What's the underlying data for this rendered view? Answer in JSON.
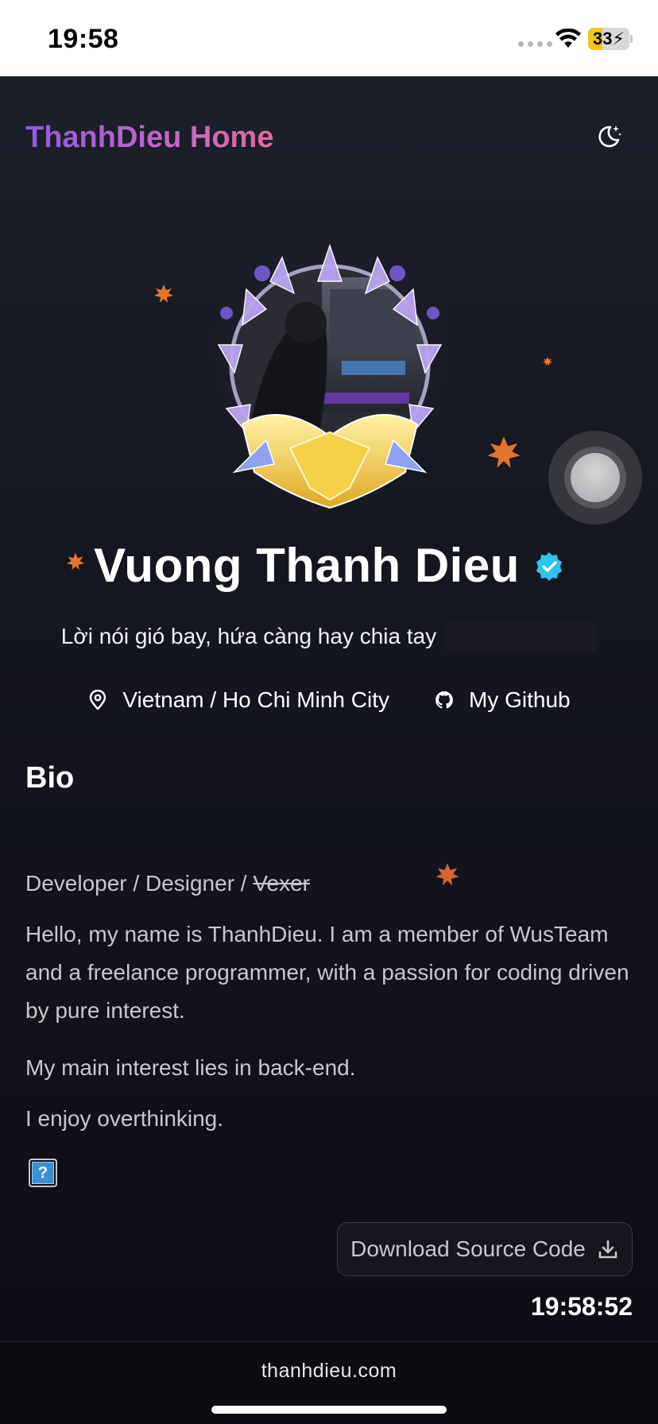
{
  "status_bar": {
    "time": "19:58",
    "battery": "33"
  },
  "header": {
    "title": "ThanhDieu Home",
    "theme_toggle_icon": "moon-stars-icon"
  },
  "profile": {
    "name": "Vuong Thanh Dieu",
    "verified_icon": "verified-badge-icon",
    "tagline": "Lời nói gió bay, hứa càng hay chia tay",
    "location": "Vietnam / Ho Chi Minh City",
    "github_label": "My Github"
  },
  "bio": {
    "heading": "Bio",
    "roles_prefix": "Developer / Designer / ",
    "roles_struck": "Vexer",
    "paragraph1": "Hello, my name is ThanhDieu. I am a member of WusTeam and a freelance programmer, with a passion for coding driven by pure interest.",
    "paragraph2": "My main interest lies in back-end.",
    "paragraph3": "I enjoy overthinking.",
    "emoji_placeholder": "?"
  },
  "actions": {
    "download_label": "Download Source Code",
    "clock": "19:58:52"
  },
  "footer": {
    "domain": "thanhdieu.com"
  },
  "colors": {
    "accent_purple": "#8e5be0",
    "accent_pink": "#e06b9a",
    "verified_blue": "#2ec4f0",
    "leaf_orange": "#e8742a"
  }
}
